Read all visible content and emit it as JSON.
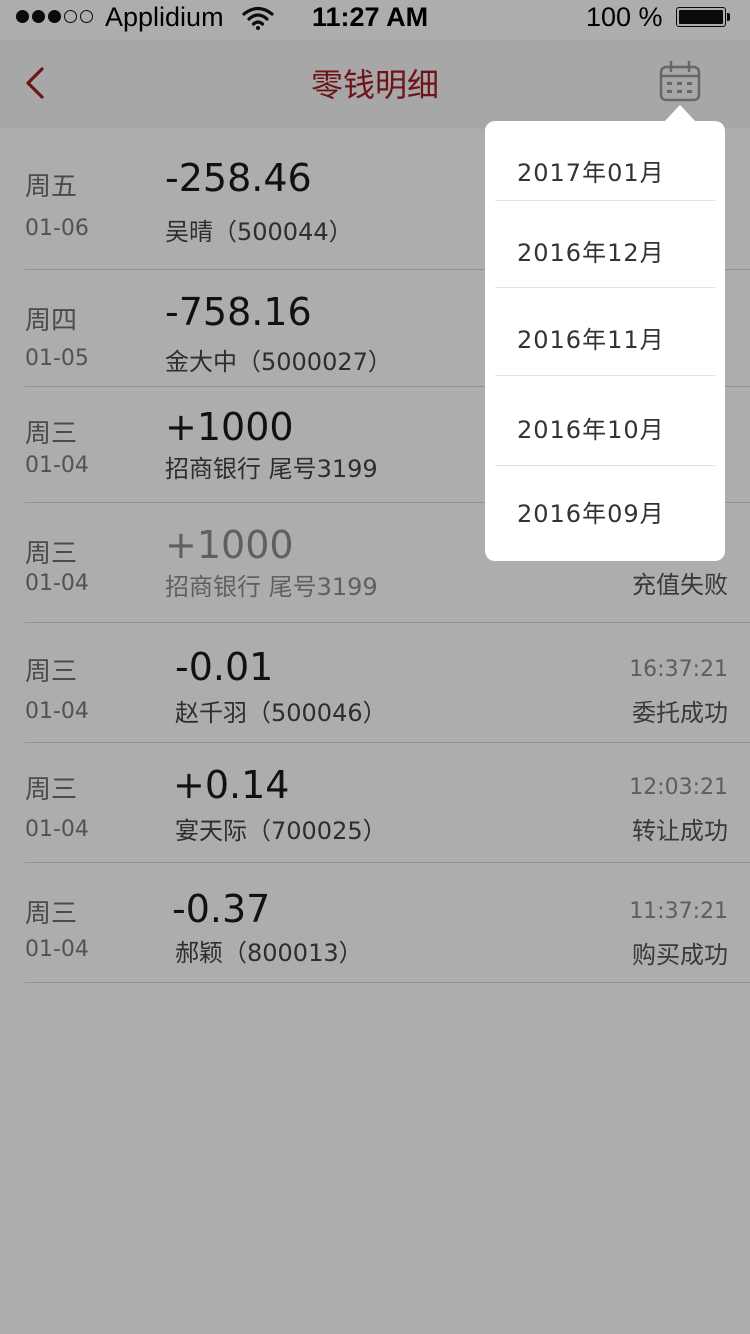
{
  "status_bar": {
    "carrier": "Applidium",
    "time": "11:27 AM",
    "battery": "100 %"
  },
  "nav": {
    "title": "零钱明细",
    "back_icon": "chevron-left-icon",
    "calendar_icon": "calendar-icon",
    "accent_color": "#a31d26"
  },
  "transactions": [
    {
      "weekday": "周五",
      "date": "01-06",
      "amount": "-258.46",
      "party": "吴晴（500044）",
      "time": "",
      "status": ""
    },
    {
      "weekday": "周四",
      "date": "01-05",
      "amount": "-758.16",
      "party": "金大中（5000027）",
      "time": "",
      "status": ""
    },
    {
      "weekday": "周三",
      "date": "01-04",
      "amount": "+1000",
      "party": "招商银行   尾号3199",
      "time": "",
      "status": ""
    },
    {
      "weekday": "周三",
      "date": "01-04",
      "amount": "+1000",
      "party": "招商银行   尾号3199",
      "time": "",
      "status": "充值失败"
    },
    {
      "weekday": "周三",
      "date": "01-04",
      "amount": "-0.01",
      "party": "赵千羽（500046）",
      "time": "16:37:21",
      "status": "委托成功"
    },
    {
      "weekday": "周三",
      "date": "01-04",
      "amount": "+0.14",
      "party": "宴天际（700025）",
      "time": "12:03:21",
      "status": "转让成功"
    },
    {
      "weekday": "周三",
      "date": "01-04",
      "amount": "-0.37",
      "party": "郝颖（800013）",
      "time": "11:37:21",
      "status": "购买成功"
    }
  ],
  "month_menu": {
    "items": [
      "2017年01月",
      "2016年12月",
      "2016年11月",
      "2016年10月",
      "2016年09月"
    ]
  }
}
